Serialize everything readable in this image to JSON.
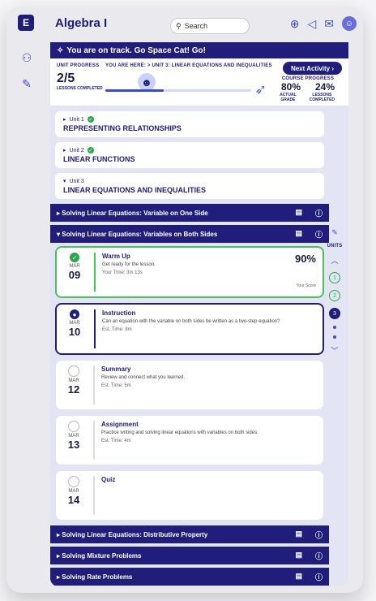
{
  "app": {
    "title": "Algebra I",
    "logo_letter": "E"
  },
  "search": {
    "placeholder": "Search"
  },
  "banner": {
    "text": "You are on track. Go Space Cat! Go!"
  },
  "progress": {
    "unit_label": "UNIT PROGRESS",
    "count": "2/5",
    "lessons_completed": "LESSONS COMPLETED",
    "you_are_here": "YOU ARE HERE: > UNIT 3: LINEAR EQUATIONS AND INEQUALITIES",
    "fraction": 0.4,
    "next_label": "Next Activity",
    "course_label": "COURSE PROGRESS",
    "actual_pct": "80%",
    "lessons_pct": "24%",
    "actual_label": "ACTUAL GRADE",
    "lessons_label": "LESSONS COMPLETED"
  },
  "units": [
    {
      "num": "Unit 1",
      "title": "REPRESENTING RELATIONSHIPS",
      "done": true
    },
    {
      "num": "Unit 2",
      "title": "LINEAR FUNCTIONS",
      "done": true
    },
    {
      "num": "Unit 3",
      "title": "LINEAR EQUATIONS AND INEQUALITIES",
      "done": false
    }
  ],
  "lessons": [
    {
      "title": "Solving Linear Equations: Variable on One Side"
    },
    {
      "title": "Solving Linear Equations: Variables on Both Sides"
    },
    {
      "title": "Solving Linear Equations: Distributive Property"
    },
    {
      "title": "Solving Mixture Problems"
    },
    {
      "title": "Solving Rate Problems"
    }
  ],
  "activities": [
    {
      "month": "MAR",
      "day": "09",
      "title": "Warm Up",
      "desc": "Get ready for the lesson.",
      "meta": "Your Time: 3m 13s",
      "score": "90%",
      "score_label": "Your Score",
      "state": "done"
    },
    {
      "month": "MAR",
      "day": "10",
      "title": "Instruction",
      "desc": "Can an equation with the variable on both sides be written as a two-step equation?",
      "meta": "Est. Time: 8m",
      "state": "current"
    },
    {
      "month": "MAR",
      "day": "12",
      "title": "Summary",
      "desc": "Review and connect what you learned.",
      "meta": "Est. Time: 5m",
      "state": "todo"
    },
    {
      "month": "MAR",
      "day": "13",
      "title": "Assignment",
      "desc": "Practice writing and solving linear equations with variables on both sides.",
      "meta": "Est. Time: 4m",
      "state": "todo"
    },
    {
      "month": "MAR",
      "day": "14",
      "title": "Quiz",
      "desc": "",
      "meta": "",
      "state": "todo"
    }
  ],
  "right_rail": {
    "units_label": "UNITS",
    "nums": [
      "1",
      "2",
      "3"
    ]
  }
}
